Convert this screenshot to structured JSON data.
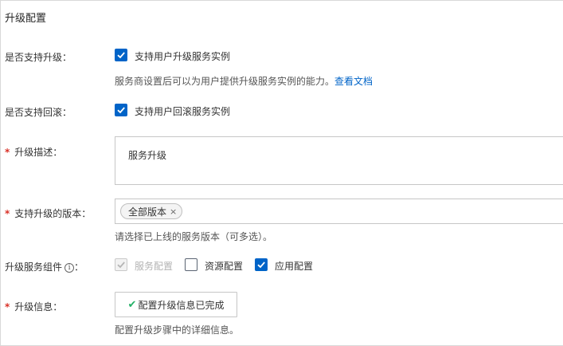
{
  "section_title": "升级配置",
  "upgrade_support": {
    "label": "是否支持升级：",
    "checkbox_label": "支持用户升级服务实例",
    "checked": true,
    "help_text": "服务商设置后可以为用户提供升级服务实例的能力。",
    "help_link": "查看文档"
  },
  "rollback_support": {
    "label": "是否支持回滚：",
    "checkbox_label": "支持用户回滚服务实例",
    "checked": true
  },
  "upgrade_description": {
    "label": "升级描述：",
    "required_mark": "*",
    "value": "服务升级"
  },
  "supported_versions": {
    "label": "支持升级的版本：",
    "required_mark": "*",
    "tags": [
      "全部版本"
    ],
    "tag_remove_glyph": "×",
    "help_text": "请选择已上线的服务版本（可多选）。"
  },
  "upgrade_components": {
    "label": "升级服务组件",
    "info_icon_glyph": "i",
    "options": [
      {
        "label": "服务配置",
        "checked": true,
        "disabled": true
      },
      {
        "label": "资源配置",
        "checked": false,
        "disabled": false
      },
      {
        "label": "应用配置",
        "checked": true,
        "disabled": false
      }
    ]
  },
  "upgrade_info": {
    "label": "升级信息：",
    "required_mark": "*",
    "button_label": "配置升级信息已完成",
    "button_icon": "check-icon",
    "help_text": "配置升级步骤中的详细信息。"
  },
  "colors": {
    "primary": "#0064c8",
    "required": "#d93026",
    "success": "#23b066",
    "border": "#c6c6c6"
  }
}
